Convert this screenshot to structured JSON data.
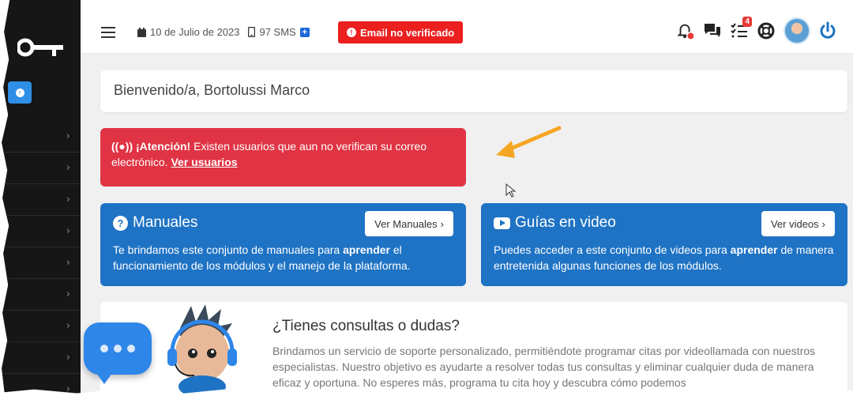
{
  "topbar": {
    "date": "10 de Julio de 2023",
    "sms": "97 SMS",
    "plus": "+",
    "email_badge": "Email no verificado",
    "tasks_count": "4"
  },
  "main": {
    "welcome": "Bienvenido/a, Bortolussi Marco",
    "alert": {
      "title": "¡Atención!",
      "text": "Existen usuarios que aun no verifican su correo electrónico.",
      "link": "Ver usuarios"
    },
    "cards": [
      {
        "title": "Manuales",
        "button": "Ver Manuales",
        "desc_pre": "Te brindamos este conjunto de manuales para",
        "desc_bold": "aprender",
        "desc_post": "el funcionamiento de los módulos y el manejo de la plataforma."
      },
      {
        "title": "Guías en video",
        "button": "Ver videos",
        "desc_pre": "Puedes acceder a este conjunto de videos para",
        "desc_bold": "aprender",
        "desc_post": "de manera entretenida algunas funciones de los módulos."
      }
    ],
    "support": {
      "title": "¿Tienes consultas o dudas?",
      "text": "Brindamos un servicio de soporte personalizado, permitiéndote programar citas por videollamada con nuestros especialistas. Nuestro objetivo es ayudarte a resolver todas tus consultas y eliminar cualquier duda de manera eficaz y oportuna. No esperes más, programa tu cita hoy y descubra cómo podemos"
    }
  },
  "icons": {
    "chevron": "›",
    "arrow_right": "›"
  },
  "colors": {
    "sidebar": "#161616",
    "accent_blue": "#1f73c4",
    "alert_red": "#e03444",
    "badge_red": "#ec1f1f"
  }
}
